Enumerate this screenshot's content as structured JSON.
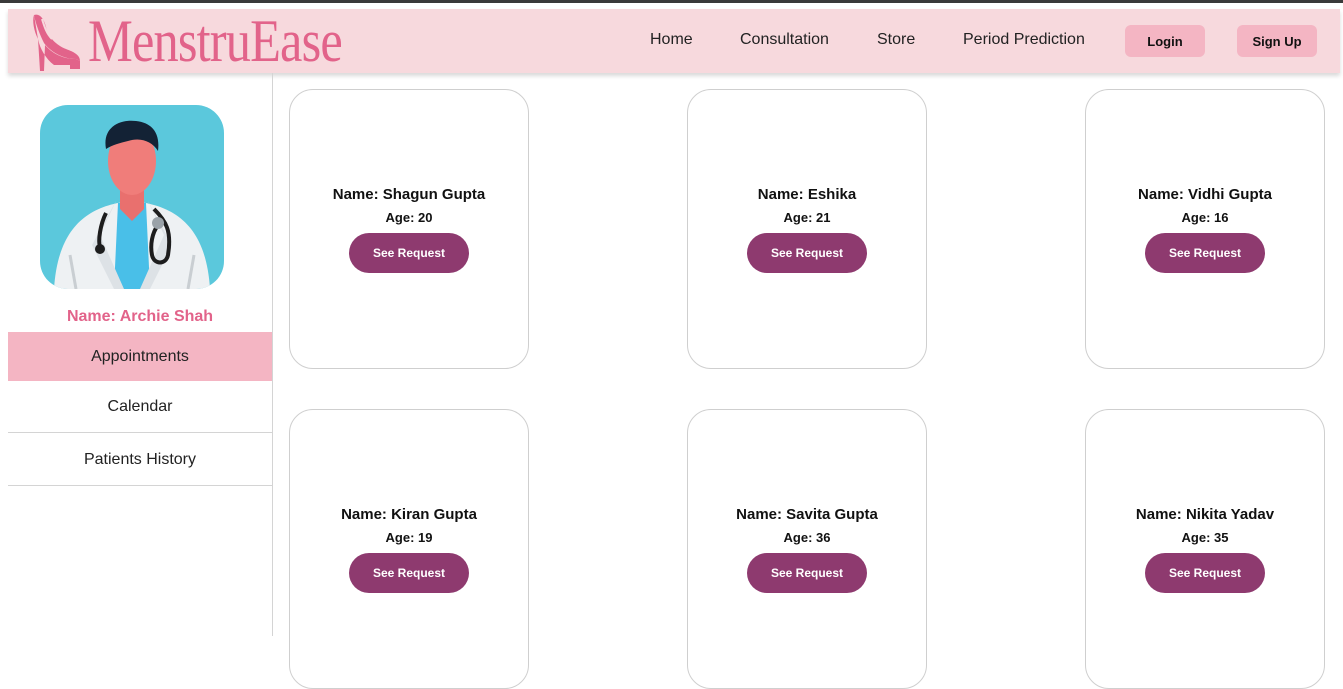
{
  "brand": {
    "name": "MenstruEase",
    "logo_icon": "high-heel-icon",
    "color": "#e2638a"
  },
  "nav": {
    "links": [
      "Home",
      "Consultation",
      "Store",
      "Period Prediction"
    ],
    "login_label": "Login",
    "signup_label": "Sign Up"
  },
  "sidebar": {
    "avatar_icon": "doctor-avatar",
    "doctor_name": "Name: Archie Shah",
    "items": [
      {
        "label": "Appointments",
        "active": true
      },
      {
        "label": "Calendar",
        "active": false
      },
      {
        "label": "Patients History",
        "active": false
      }
    ]
  },
  "patients": [
    {
      "name": "Name: Shagun Gupta",
      "age": "Age: 20",
      "button": "See Request"
    },
    {
      "name": "Name: Eshika",
      "age": "Age: 21",
      "button": "See Request"
    },
    {
      "name": "Name: Vidhi Gupta",
      "age": "Age: 16",
      "button": "See Request"
    },
    {
      "name": "Name: Kiran Gupta",
      "age": "Age: 19",
      "button": "See Request"
    },
    {
      "name": "Name: Savita Gupta",
      "age": "Age: 36",
      "button": "See Request"
    },
    {
      "name": "Name: Nikita Yadav",
      "age": "Age: 35",
      "button": "See Request"
    }
  ],
  "colors": {
    "navbar_bg": "#f7d9dd",
    "accent_pink": "#f4b5c3",
    "button_plum": "#8e3a6f",
    "avatar_bg": "#5bc8dc"
  }
}
